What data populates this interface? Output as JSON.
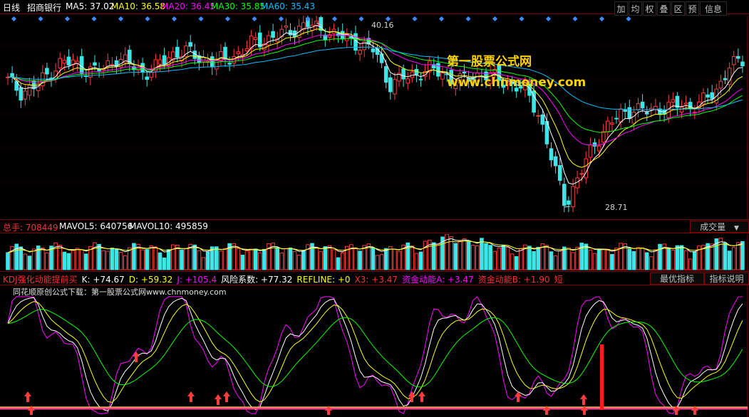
{
  "header": {
    "period": "日线",
    "stock": "招商银行",
    "ma": [
      {
        "label": "MA5: 37.02",
        "color": "#ffffff"
      },
      {
        "label": "MA10: 36.58",
        "color": "#ffff00"
      },
      {
        "label": "MA20: 36.45",
        "color": "#ff00ff"
      },
      {
        "label": "MA30: 35.85",
        "color": "#00ff00"
      },
      {
        "label": "MA60: 35.43",
        "color": "#00bfff"
      }
    ],
    "toolbar": [
      "加",
      "均",
      "权",
      "叠",
      "区",
      "预",
      "信息"
    ]
  },
  "price_panel": {
    "high_label": "40.16",
    "low_label": "28.71",
    "watermark_1": "第一股票公式网",
    "watermark_2": "www.chnmoney.com"
  },
  "volume_panel": {
    "items": [
      {
        "label": "总手: 708449",
        "color": "#ff3030"
      },
      {
        "label": "MAVOL5: 640756",
        "color": "#ffffff"
      },
      {
        "label": "MAVOL10: 495859",
        "color": "#ffffff"
      }
    ],
    "dropdown": "成交量"
  },
  "indicator_panel": {
    "items": [
      {
        "label": "KDJ强化动能提前买",
        "color": "#ff3030"
      },
      {
        "label": "K: +74.67",
        "color": "#ffffff"
      },
      {
        "label": "D: +59.32",
        "color": "#ffff00"
      },
      {
        "label": "J: +105.4",
        "color": "#ff00ff"
      },
      {
        "label": "风险系数: +77.32",
        "color": "#ffffff"
      },
      {
        "label": "REFLINE: +0",
        "color": "#ffff00"
      },
      {
        "label": "X3: +3.47",
        "color": "#ff3030"
      },
      {
        "label": "资金动能A: +3.47",
        "color": "#ff00ff"
      },
      {
        "label": "资金动能B: +1.90",
        "color": "#ff3030"
      },
      {
        "label": "短",
        "color": "#ff3030"
      }
    ],
    "note": "同花顺原创公式下载：第一股票公式网www.chnmoney.com",
    "btn_optimal": "最优指标",
    "btn_help": "指标说明"
  },
  "chart_data": [
    {
      "type": "line",
      "title": "",
      "series": [
        {
          "name": "MA5",
          "color": "#ffffff"
        },
        {
          "name": "MA10",
          "color": "#ffff00"
        },
        {
          "name": "MA20",
          "color": "#ff00ff"
        },
        {
          "name": "MA30",
          "color": "#00ff00"
        },
        {
          "name": "MA60",
          "color": "#00bfff"
        }
      ],
      "price_path": [
        36.6,
        35.8,
        36.2,
        37.0,
        37.8,
        37.6,
        37.2,
        37.3,
        38.0,
        37.6,
        37.0,
        37.5,
        38.2,
        38.5,
        38.0,
        37.8,
        37.9,
        38.3,
        39.0,
        39.2,
        39.5,
        39.8,
        40.16,
        39.8,
        39.5,
        39.2,
        38.8,
        38.5,
        36.3,
        36.7,
        37.0,
        37.3,
        37.0,
        36.5,
        36.8,
        37.0,
        36.7,
        36.3,
        36.0,
        34.5,
        31.5,
        28.71,
        30.5,
        32.4,
        33.6,
        34.4,
        34.8,
        34.6,
        34.8,
        35.0,
        34.9,
        35.2,
        35.8,
        37.5,
        37.8
      ],
      "ylim": [
        28.71,
        40.16
      ]
    },
    {
      "type": "bar",
      "series": [
        {
          "name": "总手"
        },
        {
          "name": "MAVOL5"
        },
        {
          "name": "MAVOL10"
        }
      ]
    },
    {
      "type": "line",
      "series": [
        {
          "name": "K",
          "color": "#ffffff"
        },
        {
          "name": "D",
          "color": "#ffff00"
        },
        {
          "name": "J",
          "color": "#ff00ff"
        },
        {
          "name": "风险系数",
          "color": "#00ff00"
        }
      ],
      "ylim": [
        0,
        110
      ]
    }
  ]
}
